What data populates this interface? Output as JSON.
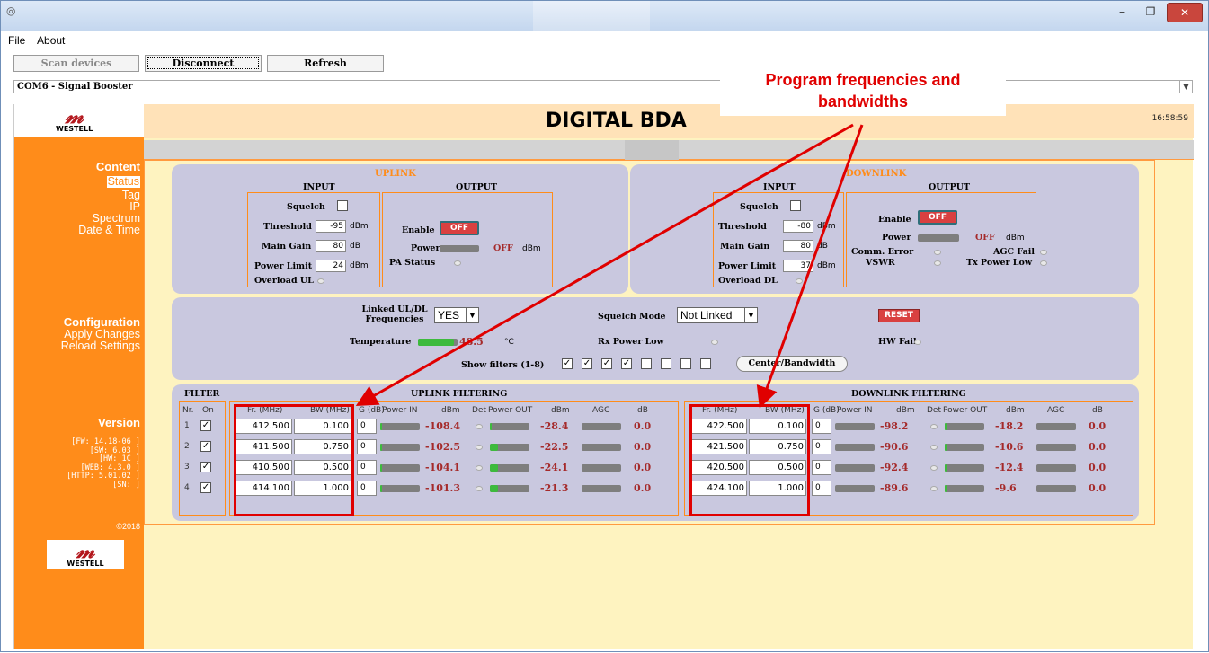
{
  "menu": {
    "file": "File",
    "about": "About"
  },
  "toolbar": {
    "scan": "Scan devices",
    "disconnect": "Disconnect",
    "refresh": "Refresh"
  },
  "device_combo": "COM6 - Signal Booster",
  "header": {
    "title": "DIGITAL BDA",
    "clock": "16:58:59"
  },
  "logo": {
    "brand": "WESTELL"
  },
  "sidebar": {
    "content_heading": "Content",
    "content_items": [
      "Status",
      "Tag",
      "IP",
      "Spectrum",
      "Date & Time"
    ],
    "config_heading": "Configuration",
    "config_items": [
      "Apply Changes",
      "Reload Settings"
    ],
    "version_heading": "Version",
    "version_lines": [
      "[FW: 14.18-06 ]",
      "[SW: 6.03 ]",
      "[HW:   1C ]",
      "[WEB: 4.3.0 ]",
      "[HTTP: 5.01.02 ]",
      "[SN: ]"
    ],
    "copyright": "©2018"
  },
  "uplink": {
    "title": "UPLINK",
    "input_label": "INPUT",
    "output_label": "OUTPUT",
    "squelch": "Squelch",
    "threshold": "Threshold",
    "threshold_value": "-95",
    "main_gain": "Main Gain",
    "main_gain_value": "80",
    "power_limit": "Power Limit",
    "power_limit_value": "24",
    "overload": "Overload UL",
    "enable": "Enable",
    "enable_state": "OFF",
    "power": "Power",
    "power_state": "OFF",
    "pa_status": "PA Status",
    "dbm": "dBm",
    "db": "dB"
  },
  "downlink": {
    "title": "DOWNLINK",
    "input_label": "INPUT",
    "output_label": "OUTPUT",
    "squelch": "Squelch",
    "threshold": "Threshold",
    "threshold_value": "-80",
    "main_gain": "Main Gain",
    "main_gain_value": "80",
    "power_limit": "Power Limit",
    "power_limit_value": "37",
    "overload": "Overload DL",
    "enable": "Enable",
    "enable_state": "OFF",
    "power": "Power",
    "power_state": "OFF",
    "comm_error": "Comm. Error",
    "agc_fail": "AGC Fail",
    "vswr": "VSWR",
    "tx_power_low": "Tx Power Low",
    "dbm": "dBm",
    "db": "dB"
  },
  "middle": {
    "linked_label": "Linked UL/DL Frequencies",
    "linked_value": "YES",
    "squelch_mode_label": "Squelch Mode",
    "squelch_mode_value": "Not Linked",
    "reset": "RESET",
    "temperature_label": "Temperature",
    "temperature_value": "48.5",
    "temperature_level": 0.9,
    "temperature_unit": "°C",
    "rx_power_low": "Rx Power Low",
    "hw_fail": "HW Fail",
    "show_filters": "Show filters (1-8)",
    "show_filters_checked": [
      true,
      true,
      true,
      true,
      false,
      false,
      false,
      false
    ],
    "center_bandwidth": "Center/Bandwidth"
  },
  "filter": {
    "title": "FILTER",
    "nr_label": "Nr.",
    "on_label": "On",
    "numbers": [
      "1",
      "2",
      "3",
      "4"
    ],
    "uplink_title": "UPLINK FILTERING",
    "downlink_title": "DOWNLINK FILTERING",
    "cols": {
      "fr": "Fr. (MHz)",
      "bw": "BW (MHz)",
      "g": "G (dB)",
      "pin": "Power IN",
      "dbm": "dBm",
      "det": "Det",
      "pout": "Power OUT",
      "agc": "AGC",
      "db": "dB"
    },
    "uplink_rows": [
      {
        "fr": "412.500",
        "bw": "0.100",
        "g": "0",
        "pin": "-108.4",
        "pout": "-28.4",
        "pin_level": 0.05,
        "pout_level": 0.05,
        "agc": "0.0"
      },
      {
        "fr": "411.500",
        "bw": "0.750",
        "g": "0",
        "pin": "-102.5",
        "pout": "-22.5",
        "pin_level": 0.05,
        "pout_level": 0.2,
        "agc": "0.0"
      },
      {
        "fr": "410.500",
        "bw": "0.500",
        "g": "0",
        "pin": "-104.1",
        "pout": "-24.1",
        "pin_level": 0.05,
        "pout_level": 0.2,
        "agc": "0.0"
      },
      {
        "fr": "414.100",
        "bw": "1.000",
        "g": "0",
        "pin": "-101.3",
        "pout": "-21.3",
        "pin_level": 0.05,
        "pout_level": 0.2,
        "agc": "0.0"
      }
    ],
    "downlink_rows": [
      {
        "fr": "422.500",
        "bw": "0.100",
        "g": "0",
        "pin": "-98.2",
        "pout": "-18.2",
        "pin_level": 0,
        "pout_level": 0.05,
        "agc": "0.0"
      },
      {
        "fr": "421.500",
        "bw": "0.750",
        "g": "0",
        "pin": "-90.6",
        "pout": "-10.6",
        "pin_level": 0,
        "pout_level": 0.05,
        "agc": "0.0"
      },
      {
        "fr": "420.500",
        "bw": "0.500",
        "g": "0",
        "pin": "-92.4",
        "pout": "-12.4",
        "pin_level": 0,
        "pout_level": 0.05,
        "agc": "0.0"
      },
      {
        "fr": "424.100",
        "bw": "1.000",
        "g": "0",
        "pin": "-89.6",
        "pout": "-9.6",
        "pin_level": 0,
        "pout_level": 0.05,
        "agc": "0.0"
      }
    ]
  },
  "annotation": {
    "line1": "Program frequencies and",
    "line2": "bandwidths"
  },
  "colors": {
    "sidebar": "#ff8c1a",
    "page_bg": "#fef3c0",
    "panel": "#c9c8df",
    "annotation": "#e00000"
  }
}
